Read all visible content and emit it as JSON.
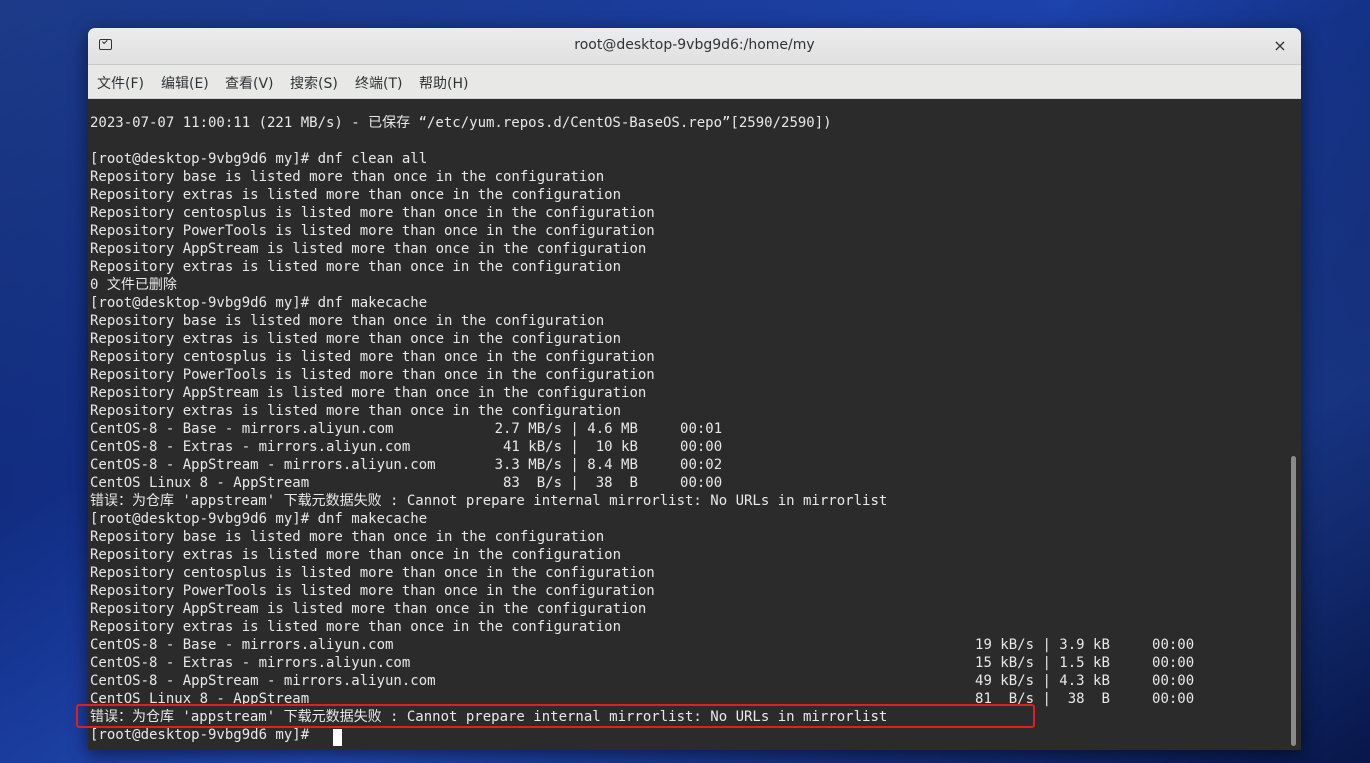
{
  "window": {
    "title": "root@desktop-9vbg9d6:/home/my",
    "close_glyph": "×",
    "icon": "terminal-icon"
  },
  "menu": [
    {
      "label": "文件(F)"
    },
    {
      "label": "编辑(E)"
    },
    {
      "label": "查看(V)"
    },
    {
      "label": "搜索(S)"
    },
    {
      "label": "终端(T)"
    },
    {
      "label": "帮助(H)"
    }
  ],
  "terminal": {
    "lines": [
      "2023-07-07 11:00:11 (221 MB/s) - 已保存 “/etc/yum.repos.d/CentOS-BaseOS.repo”[2590/2590])",
      "",
      "[root@desktop-9vbg9d6 my]# dnf clean all",
      "Repository base is listed more than once in the configuration",
      "Repository extras is listed more than once in the configuration",
      "Repository centosplus is listed more than once in the configuration",
      "Repository PowerTools is listed more than once in the configuration",
      "Repository AppStream is listed more than once in the configuration",
      "Repository extras is listed more than once in the configuration",
      "0 文件已删除",
      "[root@desktop-9vbg9d6 my]# dnf makecache",
      "Repository base is listed more than once in the configuration",
      "Repository extras is listed more than once in the configuration",
      "Repository centosplus is listed more than once in the configuration",
      "Repository PowerTools is listed more than once in the configuration",
      "Repository AppStream is listed more than once in the configuration",
      "Repository extras is listed more than once in the configuration",
      "CentOS-8 - Base - mirrors.aliyun.com            2.7 MB/s | 4.6 MB     00:01",
      "CentOS-8 - Extras - mirrors.aliyun.com           41 kB/s |  10 kB     00:00",
      "CentOS-8 - AppStream - mirrors.aliyun.com       3.3 MB/s | 8.4 MB     00:02",
      "CentOS Linux 8 - AppStream                       83  B/s |  38  B     00:00",
      "错误：为仓库 'appstream' 下载元数据失败 : Cannot prepare internal mirrorlist: No URLs in mirrorlist",
      "[root@desktop-9vbg9d6 my]# dnf makecache",
      "Repository base is listed more than once in the configuration",
      "Repository extras is listed more than once in the configuration",
      "Repository centosplus is listed more than once in the configuration",
      "Repository PowerTools is listed more than once in the configuration",
      "Repository AppStream is listed more than once in the configuration",
      "Repository extras is listed more than once in the configuration",
      "CentOS-8 - Base - mirrors.aliyun.com                                                                     19 kB/s | 3.9 kB     00:00",
      "CentOS-8 - Extras - mirrors.aliyun.com                                                                   15 kB/s | 1.5 kB     00:00",
      "CentOS-8 - AppStream - mirrors.aliyun.com                                                                49 kB/s | 4.3 kB     00:00",
      "CentOS Linux 8 - AppStream                                                                               81  B/s |  38  B     00:00",
      "错误：为仓库 'appstream' 下载元数据失败 : Cannot prepare internal mirrorlist: No URLs in mirrorlist",
      "[root@desktop-9vbg9d6 my]# "
    ]
  },
  "colors": {
    "terminal_bg": "#2b2b2b",
    "terminal_fg": "#e8e8e8",
    "highlight": "#e02020"
  }
}
